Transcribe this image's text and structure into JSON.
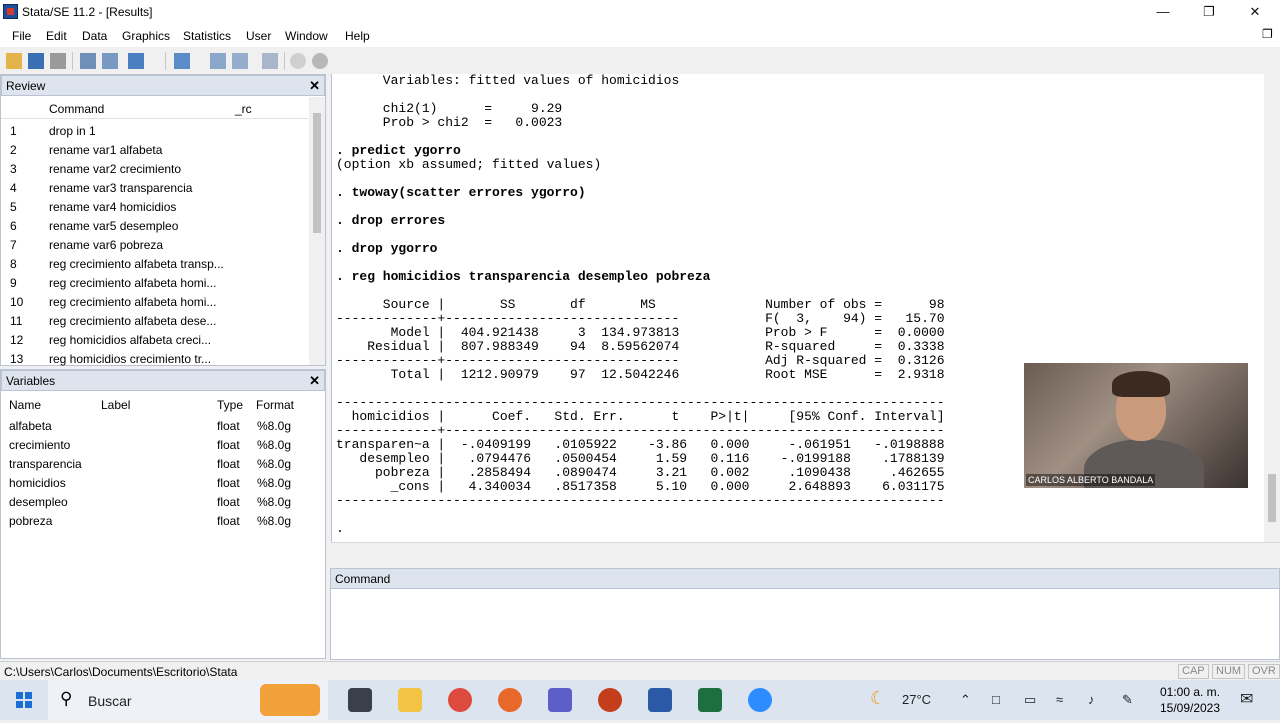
{
  "window": {
    "title": "Stata/SE 11.2 - [Results]"
  },
  "menu": [
    "File",
    "Edit",
    "Data",
    "Graphics",
    "Statistics",
    "User",
    "Window",
    "Help"
  ],
  "review": {
    "title": "Review",
    "col_command": "Command",
    "col_rc": "_rc",
    "rows": [
      {
        "n": "1",
        "cmd": "drop in 1"
      },
      {
        "n": "2",
        "cmd": "rename var1 alfabeta"
      },
      {
        "n": "3",
        "cmd": "rename var2 crecimiento"
      },
      {
        "n": "4",
        "cmd": "rename var3 transparencia"
      },
      {
        "n": "5",
        "cmd": "rename var4 homicidios"
      },
      {
        "n": "6",
        "cmd": "rename var5 desempleo"
      },
      {
        "n": "7",
        "cmd": "rename var6 pobreza"
      },
      {
        "n": "8",
        "cmd": "reg crecimiento alfabeta transp..."
      },
      {
        "n": "9",
        "cmd": "reg crecimiento alfabeta homi..."
      },
      {
        "n": "10",
        "cmd": "reg crecimiento alfabeta homi..."
      },
      {
        "n": "11",
        "cmd": "reg crecimiento alfabeta dese..."
      },
      {
        "n": "12",
        "cmd": "reg  homicidios alfabeta creci..."
      },
      {
        "n": "13",
        "cmd": "reg  homicidios crecimiento tr..."
      }
    ]
  },
  "variables": {
    "title": "Variables",
    "cols": {
      "name": "Name",
      "label": "Label",
      "type": "Type",
      "format": "Format"
    },
    "rows": [
      {
        "name": "alfabeta",
        "type": "float",
        "format": "%8.0g"
      },
      {
        "name": "crecimiento",
        "type": "float",
        "format": "%8.0g"
      },
      {
        "name": "transparencia",
        "type": "float",
        "format": "%8.0g"
      },
      {
        "name": "homicidios",
        "type": "float",
        "format": "%8.0g"
      },
      {
        "name": "desempleo",
        "type": "float",
        "format": "%8.0g"
      },
      {
        "name": "pobreza",
        "type": "float",
        "format": "%8.0g"
      }
    ]
  },
  "results": {
    "lines": [
      "      Variables: fitted values of homicidios",
      "",
      "      chi2(1)      =     9.29",
      "      Prob > chi2  =   0.0023",
      "",
      ". predict ygorro",
      "(option xb assumed; fitted values)",
      "",
      ". twoway(scatter errores ygorro)",
      "",
      ". drop errores",
      "",
      ". drop ygorro",
      "",
      ". reg homicidios transparencia desempleo pobreza",
      "",
      "      Source |       SS       df       MS              Number of obs =      98",
      "-------------+------------------------------           F(  3,    94) =   15.70",
      "       Model |  404.921438     3  134.973813           Prob > F      =  0.0000",
      "    Residual |  807.988349    94  8.59562074           R-squared     =  0.3338",
      "-------------+------------------------------           Adj R-squared =  0.3126",
      "       Total |  1212.90979    97  12.5042246           Root MSE      =  2.9318",
      "",
      "------------------------------------------------------------------------------",
      "  homicidios |      Coef.   Std. Err.      t    P>|t|     [95% Conf. Interval]",
      "-------------+----------------------------------------------------------------",
      "transparen~a |  -.0409199   .0105922    -3.86   0.000     -.061951   -.0198888",
      "   desempleo |   .0794476   .0500454     1.59   0.116    -.0199188    .1788139",
      "     pobreza |   .2858494   .0890474     3.21   0.002     .1090438     .462655",
      "       _cons |   4.340034   .8517358     5.10   0.000     2.648893    6.031175",
      "------------------------------------------------------------------------------",
      "",
      "."
    ]
  },
  "command": {
    "title": "Command"
  },
  "status": {
    "path": "C:\\Users\\Carlos\\Documents\\Escritorio\\Stata",
    "cap": "CAP",
    "num": "NUM",
    "ovr": "OVR"
  },
  "webcam": {
    "name": "CARLOS ALBERTO BANDALA"
  },
  "taskbar": {
    "search": "Buscar",
    "temp": "27°C",
    "time": "01:00 a. m.",
    "date": "15/09/2023"
  }
}
